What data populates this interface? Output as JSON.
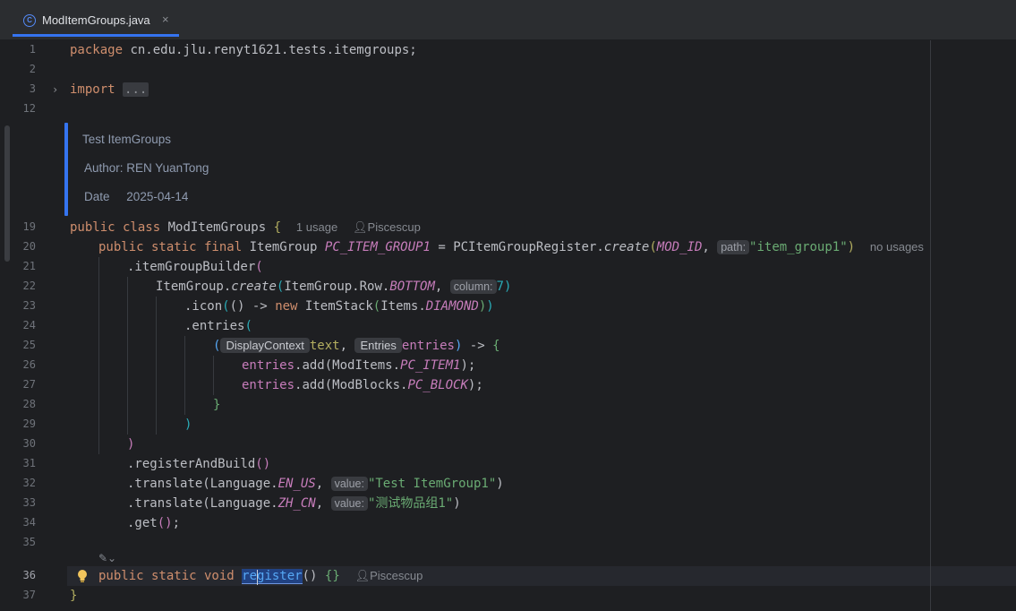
{
  "tab": {
    "label": "ModItemGroups.java",
    "close": "×",
    "icon_letter": "C"
  },
  "gutter": {
    "line_numbers": [
      "1",
      "2",
      "3",
      "12",
      "19",
      "20",
      "21",
      "22",
      "23",
      "24",
      "25",
      "26",
      "27",
      "28",
      "29",
      "30",
      "31",
      "32",
      "33",
      "34",
      "35",
      "36",
      "37"
    ],
    "current_line": "36"
  },
  "code": {
    "l1": {
      "kw": "package",
      "rest": " cn.edu.jlu.renyt1621.tests.itemgroups;"
    },
    "l3": {
      "kw": "import",
      "folded": "..."
    },
    "doc": {
      "title": "Test ItemGroups",
      "author_label": "Author:",
      "author": "REN YuanTong",
      "date_label": "Date",
      "date": "2025-04-14"
    },
    "l19": {
      "kw": "public class",
      "name": "ModItemGroups",
      "brace": "{",
      "usages": "1 usage",
      "author": "Piscescup"
    },
    "l20": {
      "kw": "public static final",
      "type": "ItemGroup",
      "field": "PC_ITEM_GROUP1",
      "eq": " = PCItemGroupRegister.",
      "method": "create",
      "arg": "MOD_ID",
      "hint": "path:",
      "str": "\"item_group1\"",
      "usages": "no usages"
    },
    "l21": {
      "text": ".itemGroupBuilder"
    },
    "l22": {
      "cls": "ItemGroup.",
      "method": "create",
      "arg": "ItemGroup.Row.",
      "field": "BOTTOM",
      "hint": "column:",
      "num": "7"
    },
    "l23": {
      "call": ".icon",
      "lambda": "() ->",
      "kw": "new",
      "cls": "ItemStack",
      "arg": "Items.",
      "field": "DIAMOND"
    },
    "l24": {
      "text": ".entries"
    },
    "l25": {
      "hint1": "DisplayContext",
      "p1": "text",
      "hint2": "Entries",
      "p2": "entries",
      "arrow": " -> "
    },
    "l26": {
      "var": "entries",
      "call": ".add(ModItems.",
      "field": "PC_ITEM1"
    },
    "l27": {
      "var": "entries",
      "call": ".add(ModBlocks.",
      "field": "PC_BLOCK"
    },
    "l31": {
      "text": ".registerAndBuild"
    },
    "l32": {
      "call": ".translate(Language.",
      "field": "EN_US",
      "hint": "value:",
      "str": "\"Test ItemGroup1\""
    },
    "l33": {
      "call": ".translate(Language.",
      "field": "ZH_CN",
      "hint": "value:",
      "str": "\"测试物品组1\""
    },
    "l34": {
      "text": ".get"
    },
    "l36": {
      "kw": "public static void",
      "name": "register",
      "rest": "() ",
      "author": "Piscescup"
    },
    "l37": {
      "text": "}"
    }
  },
  "colors": {
    "accent": "#3574f0",
    "keyword": "#cf8e6d",
    "string": "#6aab73",
    "field": "#c77dbb",
    "number": "#2aacb8"
  },
  "icons": {
    "tab": "java-class-icon",
    "bulb": "lightbulb-icon",
    "user": "user-icon",
    "ai": "ai-assist-icon",
    "fold": "chevron-right-icon"
  }
}
